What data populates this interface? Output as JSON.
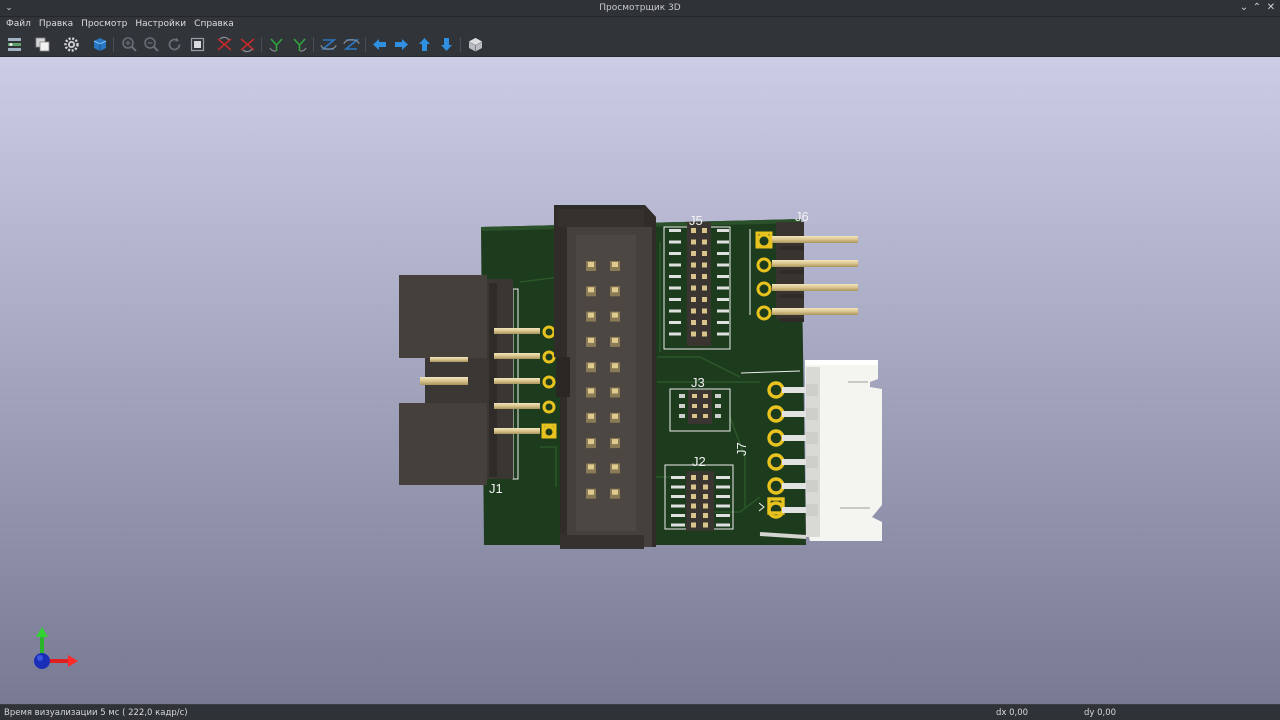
{
  "window": {
    "title": "Просмотрщик 3D",
    "menu_glyph": "⌄",
    "minimize_glyph": "⌄",
    "maximize_glyph": "⌃",
    "close_glyph": "✕"
  },
  "menubar": {
    "items": [
      "Файл",
      "Правка",
      "Просмотр",
      "Настройки",
      "Справка"
    ]
  },
  "toolbar": {
    "icons": [
      "render-settings-icon",
      "copy-image-icon",
      "preferences-gear-icon",
      "raytracing-icon",
      "zoom-in-icon",
      "zoom-out-icon",
      "redraw-icon",
      "zoom-fit-icon",
      "rotate-x-cw-icon",
      "rotate-x-ccw-icon",
      "rotate-y-cw-icon",
      "rotate-y-ccw-icon",
      "rotate-z-cw-icon",
      "rotate-z-ccw-icon",
      "arrow-left-icon",
      "arrow-right-icon",
      "arrow-up-icon",
      "arrow-down-icon",
      "view-orthographic-icon"
    ]
  },
  "board": {
    "ref_labels": {
      "j1": "J1",
      "j2": "J2",
      "j3": "J3",
      "j5": "J5",
      "j6": "J6",
      "j7": "J7"
    },
    "colors": {
      "pcb": "#1e3a1e",
      "silkscreen": "#f2f2f2",
      "copper_pad": "#e8c21f",
      "connector_body": "#45403c",
      "pin_gold": "#e5d3a0",
      "jst_housing": "#f5f5f2"
    }
  },
  "statusbar": {
    "render_time": "Время визуализации 5 мс ( 222,0 кадр/с)",
    "dx": "dx 0,00",
    "dy": "dy 0,00"
  }
}
